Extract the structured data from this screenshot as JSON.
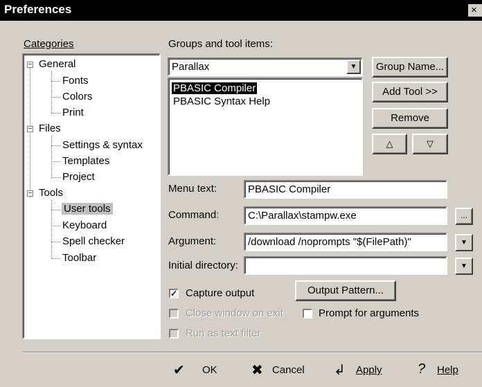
{
  "window": {
    "title": "Preferences",
    "close": "×"
  },
  "categories": {
    "label": "Categories",
    "items": [
      {
        "label": "General",
        "expander": "−"
      },
      {
        "label": "Fonts"
      },
      {
        "label": "Colors"
      },
      {
        "label": "Print"
      },
      {
        "label": "Files",
        "expander": "−"
      },
      {
        "label": "Settings & syntax"
      },
      {
        "label": "Templates"
      },
      {
        "label": "Project"
      },
      {
        "label": "Tools",
        "expander": "−"
      },
      {
        "label": "User tools"
      },
      {
        "label": "Keyboard"
      },
      {
        "label": "Spell checker"
      },
      {
        "label": "Toolbar"
      }
    ]
  },
  "groups": {
    "label": "Groups and tool items:",
    "selected": "Parallax",
    "items": [
      "PBASIC Compiler",
      "PBASIC Syntax Help"
    ]
  },
  "buttons": {
    "group_name": "Group Name...",
    "add_tool": "Add Tool >>",
    "remove": "Remove",
    "up": "△",
    "down": "▽",
    "browse": "...",
    "output_pattern": "Output Pattern..."
  },
  "fields": {
    "menu_text": {
      "label": "Menu text:",
      "value": "PBASIC Compiler"
    },
    "command": {
      "label": "Command:",
      "value": "C:\\Parallax\\stampw.exe"
    },
    "argument": {
      "label": "Argument:",
      "value": "/download /noprompts \"$(FilePath)\""
    },
    "initial_dir": {
      "label": "Initial directory:",
      "value": ""
    }
  },
  "checkboxes": {
    "capture_output": {
      "label": "Capture output",
      "checked": true,
      "mark": "✓"
    },
    "close_window": {
      "label": "Close window on exit",
      "disabled": true
    },
    "prompt_args": {
      "label": "Prompt for arguments"
    },
    "run_filter": {
      "label": "Run as text filter",
      "disabled": true
    }
  },
  "footer": {
    "ok": {
      "label": "OK",
      "icon": "✔"
    },
    "cancel": {
      "label": "Cancel",
      "icon": "✖"
    },
    "apply": {
      "label": "Apply",
      "icon": "↲"
    },
    "help": {
      "label": "Help",
      "icon": "?"
    }
  }
}
